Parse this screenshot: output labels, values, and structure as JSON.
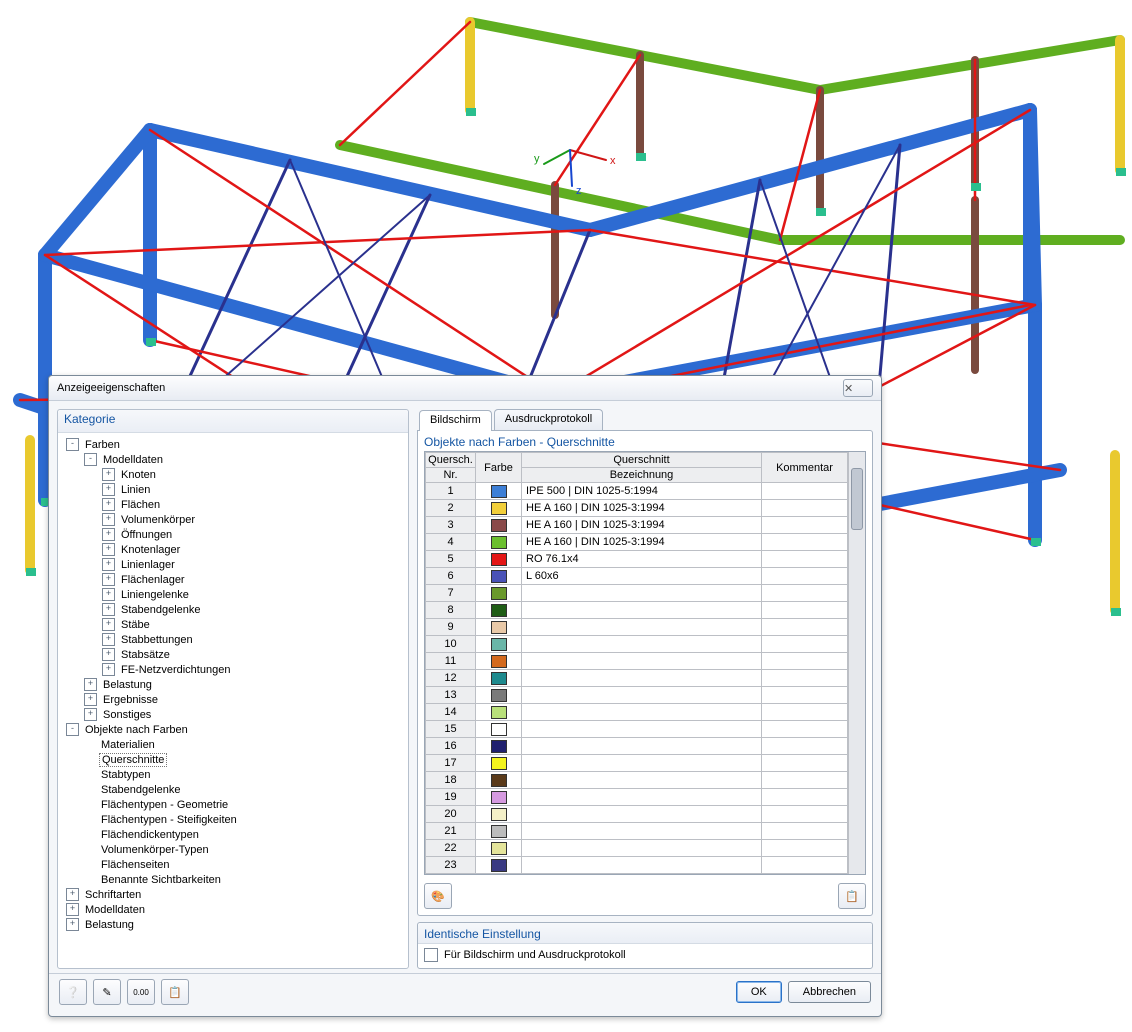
{
  "dialog": {
    "title": "Anzeigeeigenschaften",
    "close_glyph": "✕"
  },
  "category_header": "Kategorie",
  "tree": [
    {
      "depth": 0,
      "toggle": "-",
      "label": "Farben"
    },
    {
      "depth": 1,
      "toggle": "-",
      "label": "Modelldaten"
    },
    {
      "depth": 2,
      "toggle": "+",
      "label": "Knoten"
    },
    {
      "depth": 2,
      "toggle": "+",
      "label": "Linien"
    },
    {
      "depth": 2,
      "toggle": "+",
      "label": "Flächen"
    },
    {
      "depth": 2,
      "toggle": "+",
      "label": "Volumenkörper"
    },
    {
      "depth": 2,
      "toggle": "+",
      "label": "Öffnungen"
    },
    {
      "depth": 2,
      "toggle": "+",
      "label": "Knotenlager"
    },
    {
      "depth": 2,
      "toggle": "+",
      "label": "Linienlager"
    },
    {
      "depth": 2,
      "toggle": "+",
      "label": "Flächenlager"
    },
    {
      "depth": 2,
      "toggle": "+",
      "label": "Liniengelenke"
    },
    {
      "depth": 2,
      "toggle": "+",
      "label": "Stabendgelenke"
    },
    {
      "depth": 2,
      "toggle": "+",
      "label": "Stäbe"
    },
    {
      "depth": 2,
      "toggle": "+",
      "label": "Stabbettungen"
    },
    {
      "depth": 2,
      "toggle": "+",
      "label": "Stabsätze"
    },
    {
      "depth": 2,
      "toggle": "+",
      "label": "FE-Netzverdichtungen"
    },
    {
      "depth": 1,
      "toggle": "+",
      "label": "Belastung"
    },
    {
      "depth": 1,
      "toggle": "+",
      "label": "Ergebnisse"
    },
    {
      "depth": 1,
      "toggle": "+",
      "label": "Sonstiges"
    },
    {
      "depth": 0,
      "toggle": "-",
      "label": "Objekte nach Farben"
    },
    {
      "depth": 1,
      "toggle": "",
      "label": "Materialien"
    },
    {
      "depth": 1,
      "toggle": "",
      "label": "Querschnitte",
      "selected": true
    },
    {
      "depth": 1,
      "toggle": "",
      "label": "Stabtypen"
    },
    {
      "depth": 1,
      "toggle": "",
      "label": "Stabendgelenke"
    },
    {
      "depth": 1,
      "toggle": "",
      "label": "Flächentypen - Geometrie"
    },
    {
      "depth": 1,
      "toggle": "",
      "label": "Flächentypen - Steifigkeiten"
    },
    {
      "depth": 1,
      "toggle": "",
      "label": "Flächendickentypen"
    },
    {
      "depth": 1,
      "toggle": "",
      "label": "Volumenkörper-Typen"
    },
    {
      "depth": 1,
      "toggle": "",
      "label": "Flächenseiten"
    },
    {
      "depth": 1,
      "toggle": "",
      "label": "Benannte Sichtbarkeiten"
    },
    {
      "depth": 0,
      "toggle": "+",
      "label": "Schriftarten"
    },
    {
      "depth": 0,
      "toggle": "+",
      "label": "Modelldaten"
    },
    {
      "depth": 0,
      "toggle": "+",
      "label": "Belastung"
    }
  ],
  "tabs": {
    "screen": "Bildschirm",
    "print": "Ausdruckprotokoll"
  },
  "table": {
    "title": "Objekte nach Farben - Querschnitte",
    "headers": {
      "nr_top": "Quersch.",
      "nr_bottom": "Nr.",
      "color": "Farbe",
      "section_top": "Querschnitt",
      "section_bottom": "Bezeichnung",
      "comment": "Kommentar"
    },
    "rows": [
      {
        "nr": "1",
        "color": "#3d7fd6",
        "desc": "IPE 500 | DIN 1025-5:1994",
        "comment": ""
      },
      {
        "nr": "2",
        "color": "#f2cf3a",
        "desc": "HE A 160 | DIN 1025-3:1994",
        "comment": ""
      },
      {
        "nr": "3",
        "color": "#8a4a4a",
        "desc": "HE A 160 | DIN 1025-3:1994",
        "comment": ""
      },
      {
        "nr": "4",
        "color": "#6bbf2e",
        "desc": "HE A 160 | DIN 1025-3:1994",
        "comment": ""
      },
      {
        "nr": "5",
        "color": "#e41616",
        "desc": "RO 76.1x4",
        "comment": ""
      },
      {
        "nr": "6",
        "color": "#4a52b7",
        "desc": "L 60x6",
        "comment": ""
      },
      {
        "nr": "7",
        "color": "#6a992b",
        "desc": "",
        "comment": ""
      },
      {
        "nr": "8",
        "color": "#1f5d16",
        "desc": "",
        "comment": ""
      },
      {
        "nr": "9",
        "color": "#e9c9a8",
        "desc": "",
        "comment": ""
      },
      {
        "nr": "10",
        "color": "#6ab6a8",
        "desc": "",
        "comment": ""
      },
      {
        "nr": "11",
        "color": "#d46a1e",
        "desc": "",
        "comment": ""
      },
      {
        "nr": "12",
        "color": "#1e8a8e",
        "desc": "",
        "comment": ""
      },
      {
        "nr": "13",
        "color": "#7a7a7a",
        "desc": "",
        "comment": ""
      },
      {
        "nr": "14",
        "color": "#b9e07a",
        "desc": "",
        "comment": ""
      },
      {
        "nr": "15",
        "color": "#ffffff",
        "desc": "",
        "comment": ""
      },
      {
        "nr": "16",
        "color": "#20206e",
        "desc": "",
        "comment": ""
      },
      {
        "nr": "17",
        "color": "#f4f41e",
        "desc": "",
        "comment": ""
      },
      {
        "nr": "18",
        "color": "#5a3a1a",
        "desc": "",
        "comment": ""
      },
      {
        "nr": "19",
        "color": "#d69ae0",
        "desc": "",
        "comment": ""
      },
      {
        "nr": "20",
        "color": "#f4f0c8",
        "desc": "",
        "comment": ""
      },
      {
        "nr": "21",
        "color": "#bcbcbc",
        "desc": "",
        "comment": ""
      },
      {
        "nr": "22",
        "color": "#e4e49a",
        "desc": "",
        "comment": ""
      },
      {
        "nr": "23",
        "color": "#3a3a82",
        "desc": "",
        "comment": ""
      }
    ]
  },
  "identical": {
    "header": "Identische Einstellung",
    "checkbox_label": "Für Bildschirm und Ausdruckprotokoll"
  },
  "footer": {
    "ok": "OK",
    "cancel": "Abbrechen"
  }
}
